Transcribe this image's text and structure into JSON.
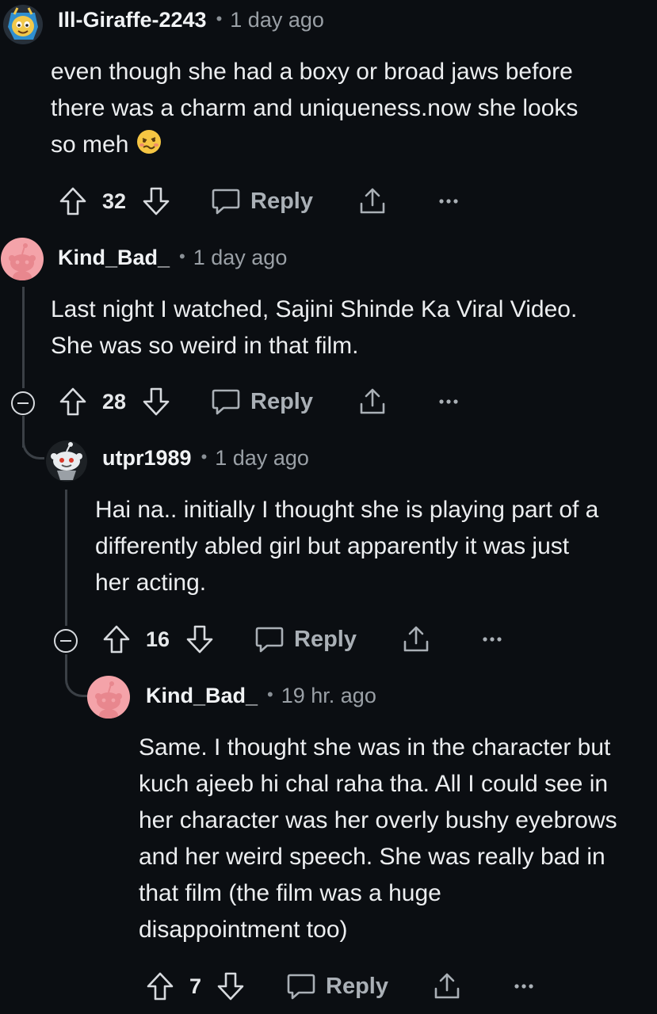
{
  "comments": [
    {
      "username": "Ill-Giraffe-2243",
      "time": "1 day ago",
      "lines": [
        "even though she had a boxy or broad jaws before",
        "there was a charm and uniqueness.now she looks",
        "so meh"
      ],
      "emoji": "🥴",
      "votes": "32",
      "reply_label": "Reply"
    },
    {
      "username": "Kind_Bad_",
      "time": "1 day ago",
      "lines": [
        "Last night I watched, Sajini Shinde Ka Viral Video.",
        "She was so weird in that film."
      ],
      "votes": "28",
      "reply_label": "Reply"
    },
    {
      "username": "utpr1989",
      "time": "1 day ago",
      "lines": [
        "Hai na.. initially I thought she is playing part of a",
        "differently abled girl but apparently it was just",
        "her acting."
      ],
      "votes": "16",
      "reply_label": "Reply"
    },
    {
      "username": "Kind_Bad_",
      "time": "19 hr. ago",
      "lines": [
        "Same. I thought she was in the character but",
        "kuch ajeeb hi chal raha tha. All I could see in",
        "her character was her overly bushy eyebrows",
        "and her weird speech. She was really bad in",
        "that film (the film was a huge",
        "disappointment too)"
      ],
      "votes": "7",
      "reply_label": "Reply"
    }
  ],
  "icons": {
    "upvote": "upvote-arrow-icon",
    "downvote": "downvote-arrow-icon",
    "reply": "speech-bubble-icon",
    "share": "share-icon",
    "more": "ellipsis-icon",
    "collapse": "collapse-minus-icon"
  },
  "colors": {
    "background": "#0b0e12",
    "text": "#eceef0",
    "muted": "#9aa0a6",
    "thread_line": "#3b4046",
    "avatar_pink": "#f4a3a9"
  }
}
